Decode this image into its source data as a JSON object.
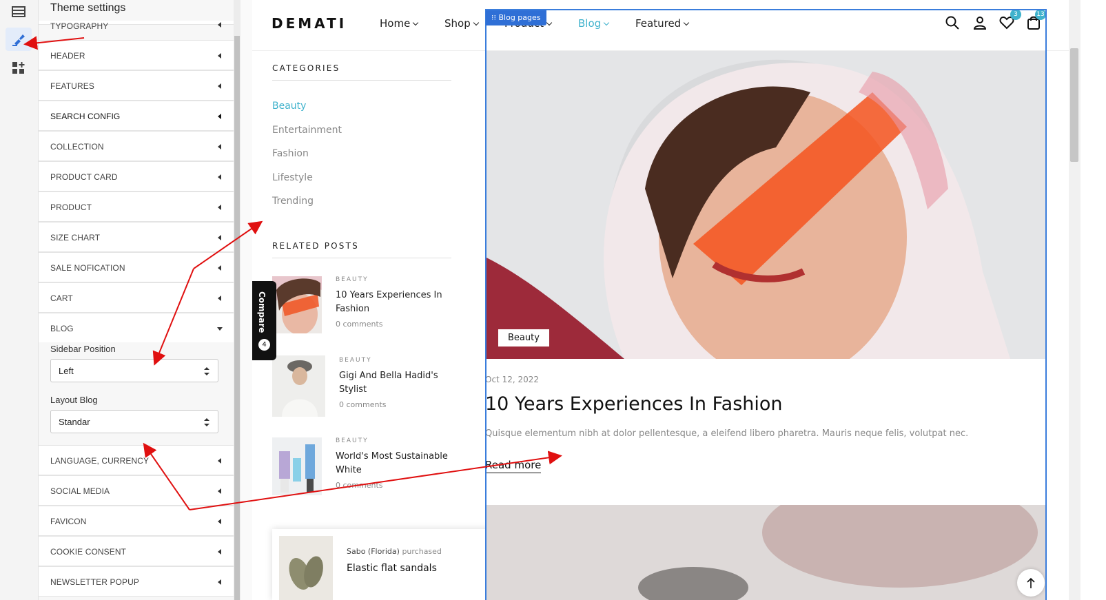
{
  "panel": {
    "title": "Theme settings",
    "sections_top": [
      {
        "label": "Typography"
      },
      {
        "label": "Header"
      },
      {
        "label": "Features"
      },
      {
        "label": "Search config"
      },
      {
        "label": "Collection"
      },
      {
        "label": "Product card"
      },
      {
        "label": "Product"
      },
      {
        "label": "Size chart"
      },
      {
        "label": "Sale nofication"
      },
      {
        "label": "Cart"
      },
      {
        "label": "Blog"
      }
    ],
    "blog": {
      "sidebar_position_label": "Sidebar Position",
      "sidebar_position_value": "Left",
      "layout_label": "Layout Blog",
      "layout_value": "Standar"
    },
    "sections_bottom": [
      {
        "label": "Language, currency"
      },
      {
        "label": "Social media"
      },
      {
        "label": "Favicon"
      },
      {
        "label": "Cookie consent"
      },
      {
        "label": "Newsletter popup"
      }
    ]
  },
  "store": {
    "logo": "DEMATI",
    "nav": [
      "Home",
      "Shop",
      "Product",
      "Blog",
      "Featured"
    ],
    "wishlist_count": "3",
    "cart_count": "13",
    "accent": "#3fb2cc"
  },
  "sidebar": {
    "categories_heading": "CATEGORIES",
    "categories": [
      "Beauty",
      "Entertainment",
      "Fashion",
      "Lifestyle",
      "Trending"
    ],
    "related_heading": "RELATED POSTS",
    "related": [
      {
        "tag": "BEAUTY",
        "title": "10 Years Experiences In Fashion",
        "comments": "0 comments"
      },
      {
        "tag": "BEAUTY",
        "title": "Gigi And Bella Hadid's Stylist",
        "comments": "0 comments"
      },
      {
        "tag": "BEAUTY",
        "title": "World's Most Sustainable White",
        "comments": "0 comments"
      }
    ]
  },
  "compare": {
    "label": "Compare",
    "count": "4"
  },
  "popup": {
    "who": "Sabo (Florida)",
    "action": "purchased",
    "product": "Elastic flat sandals"
  },
  "blog_main": {
    "frame_label": "Blog pages",
    "badge": "Beauty",
    "date": "Oct 12, 2022",
    "title": "10 Years Experiences In Fashion",
    "excerpt": "Quisque elementum nibh at dolor pellentesque, a eleifend libero pharetra. Mauris neque felis, volutpat nec...",
    "read_more": "Read more"
  }
}
